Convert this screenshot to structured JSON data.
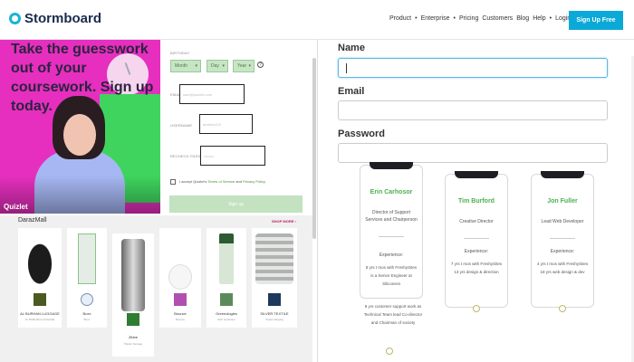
{
  "header": {
    "logo_text": "Stormboard",
    "nav": [
      "Product",
      "•",
      "Enterprise",
      "•",
      "Pricing",
      "Customers",
      "Blog",
      "Help",
      "•",
      "Login →"
    ],
    "signup_free": "Sign Up Free",
    "accent": "#0aa9d8"
  },
  "left": {
    "hero_text": "Take the guesswork out of your coursework. Sign up today.",
    "hero_brand": "Quizlet",
    "form": {
      "birthday_label": "BIRTHDAY",
      "month": "Month",
      "day": "Day",
      "year": "Year",
      "email_label": "EMAIL",
      "email_placeholder": "user@quizlet.com",
      "username_label": "USERNAME",
      "username_placeholder": "andrew123",
      "password_label": "RECHECK PASSWORD",
      "password_placeholder": "••••••••",
      "agree_prefix": "I accept Quizlet's",
      "terms": "Terms of Service",
      "and": "and",
      "privacy": "Privacy Policy",
      "signup": "Sign up"
    },
    "store": {
      "title": "DarazMall",
      "shop_more": "SHOP MORE ›",
      "items": [
        {
          "brand": "AL BURHAN LUGGAGE",
          "sub": "AL BURHAN LUGGAGE"
        },
        {
          "brand": "Buxx",
          "sub": "Buxx"
        },
        {
          "brand": "Zibbe",
          "sub": "Plastic Storage"
        },
        {
          "brand": "Bounce",
          "sub": "Bounce"
        },
        {
          "brand": "Greenologies",
          "sub": "Skin Hydration"
        },
        {
          "brand": "SILVER TEXTILE",
          "sub": "Towel Hanging"
        }
      ]
    }
  },
  "right": {
    "name_label": "Name",
    "email_label": "Email",
    "password_label": "Password",
    "team": [
      {
        "name": "Erin Carhosor",
        "role": "Director of Support Services and Chairperson",
        "exp_head": "Experience:",
        "exp": "8 yrs t mos with FreshySites is a Senior Engineer at Siliconera"
      },
      {
        "name": "Tim Burford",
        "role": "Creative Director",
        "exp_head": "Experience:",
        "exp": "7 yrs t mos with FreshySites 13 yrs design & direction"
      },
      {
        "name": "Jon Fuller",
        "role": "Lead Web Developer",
        "exp_head": "Experience:",
        "exp": "4 yrs t mos with FreshySites 18 yrs web design & dev"
      }
    ],
    "overflow_text": "8 yrs customer support work as Technical Team lead Co-director and Chairman of society"
  }
}
